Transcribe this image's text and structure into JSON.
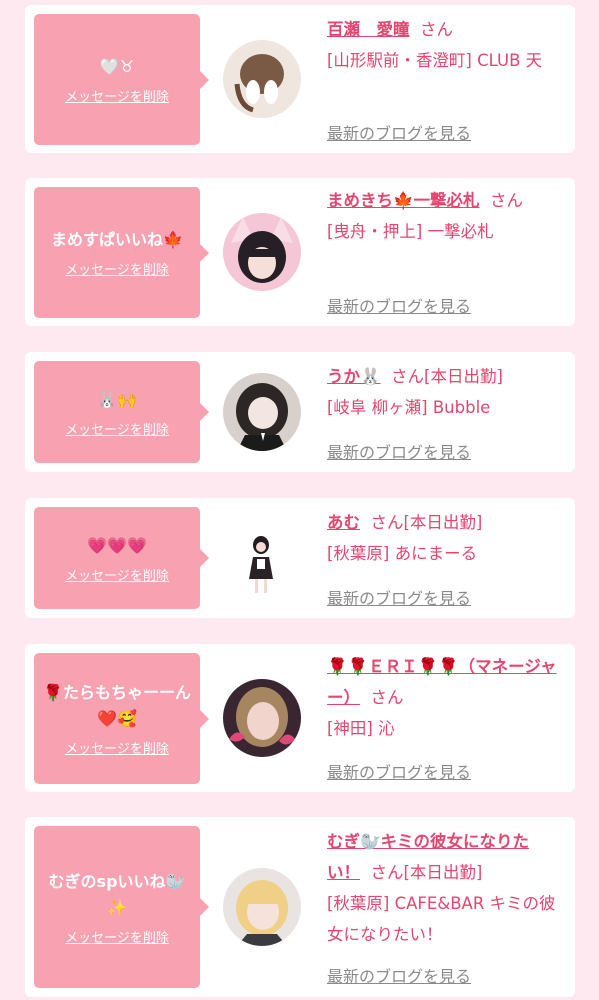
{
  "delete_label": "メッセージを削除",
  "blog_label": "最新のブログを見る",
  "san_label": "さん",
  "entries": [
    {
      "message": "🤍♉",
      "name": "百瀬　愛瞳",
      "status": "",
      "shop": "[山形駅前・香澄町] CLUB 天",
      "avatar_icon": "avatar-icon"
    },
    {
      "message": "まめすぱいいね🍁",
      "name": "まめきち🍁一撃必札",
      "status": "",
      "shop": "[曳舟・押上] 一撃必札",
      "avatar_icon": "avatar-icon"
    },
    {
      "message": "🐰🙌",
      "name": "うか🐰",
      "status": "[本日出勤]",
      "shop": "[岐阜 柳ヶ瀬] Bubble",
      "avatar_icon": "avatar-icon"
    },
    {
      "message": "💗💗💗",
      "name": "あむ",
      "status": "[本日出勤]",
      "shop": "[秋葉原] あにまーる",
      "avatar_icon": "avatar-icon"
    },
    {
      "message": "🌹たらもちゃーーん❤️🥰",
      "name": "🌹🌹ＥＲＩ🌹🌹（マネージャー）",
      "status": "",
      "shop": "[神田] 沁",
      "avatar_icon": "avatar-icon"
    },
    {
      "message": "むぎのspいいね🦭✨",
      "name": "むぎ🦭キミの彼女になりたい！",
      "status": "[本日出勤]",
      "shop": "[秋葉原] CAFE&BAR キミの彼女になりたい！",
      "avatar_icon": "avatar-icon"
    }
  ]
}
